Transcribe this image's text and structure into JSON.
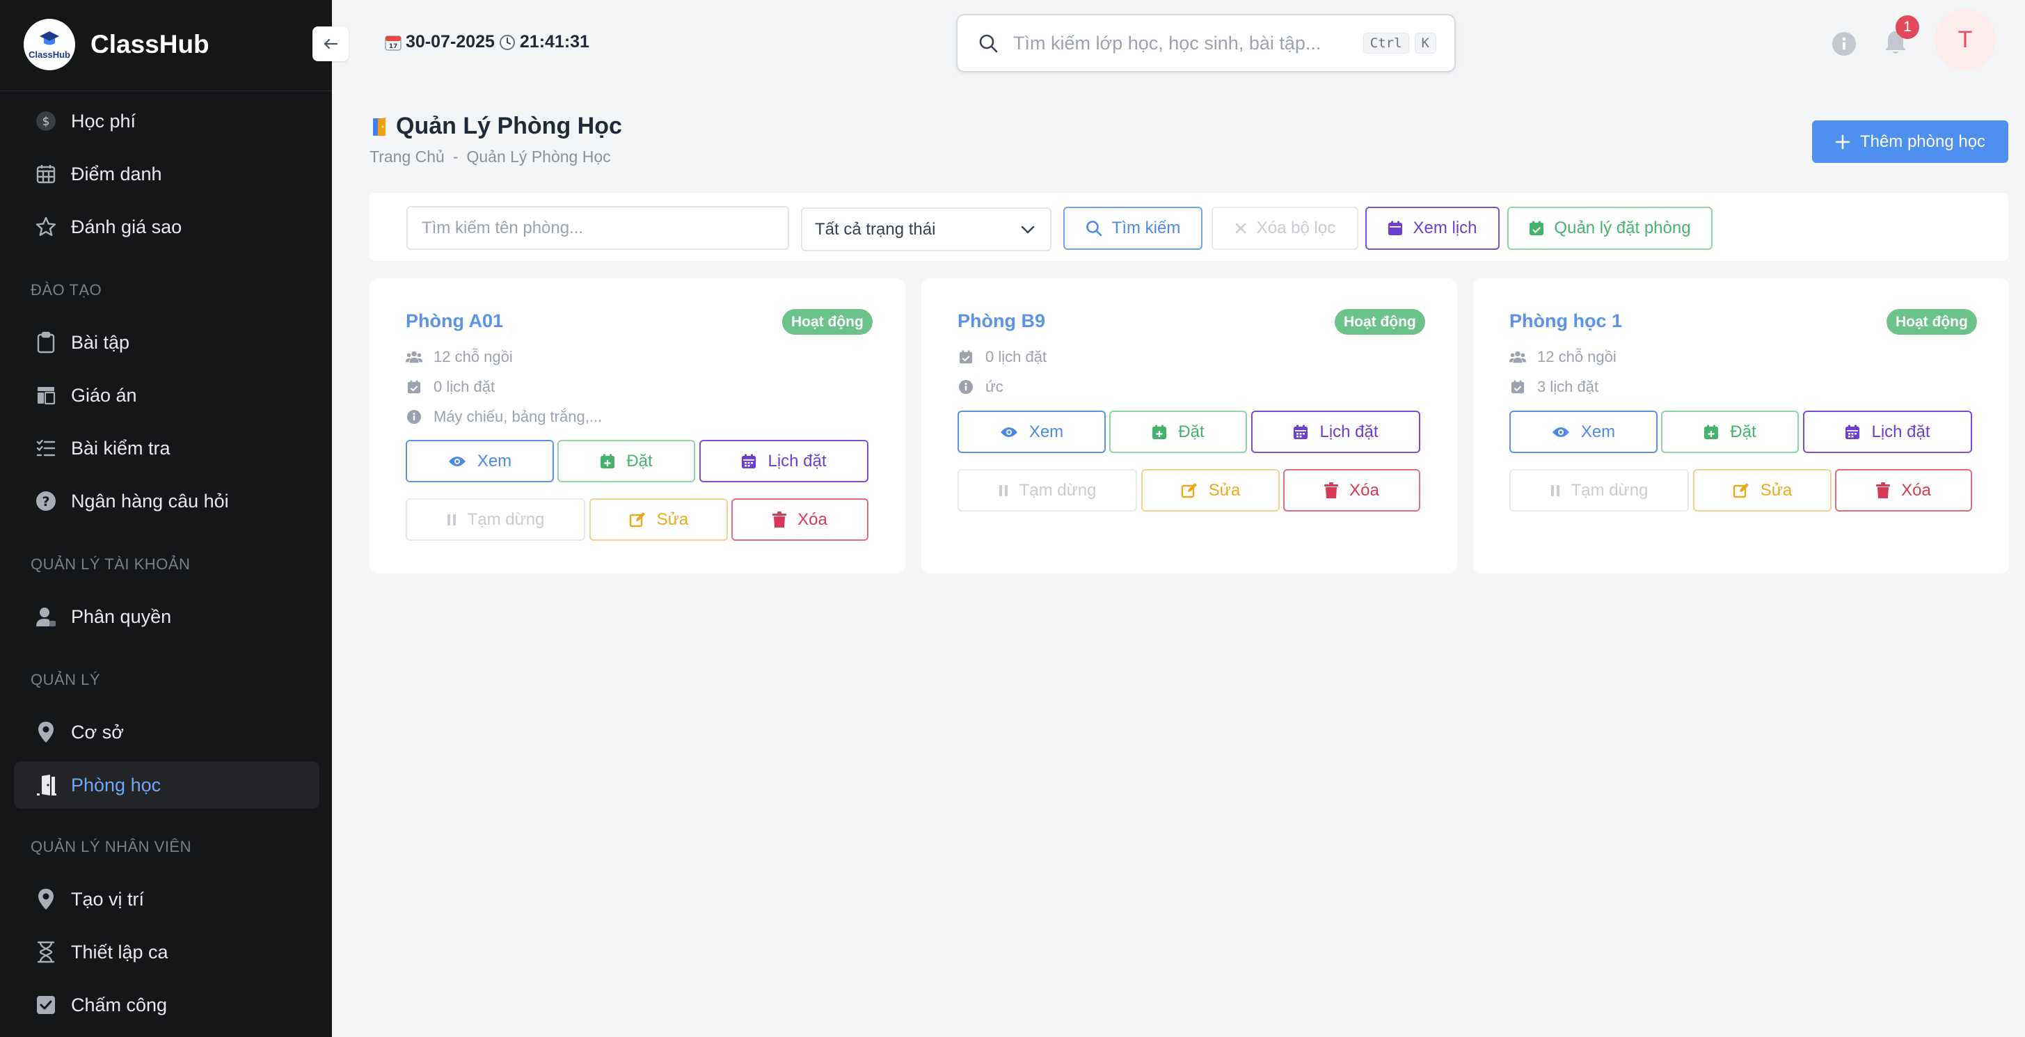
{
  "app": {
    "name": "ClassHub",
    "logo_text": "ClassHub"
  },
  "sidebar": {
    "items_top": [
      {
        "label": "Học phí",
        "icon": "dollar-icon"
      },
      {
        "label": "Điểm danh",
        "icon": "calendar-grid-icon"
      },
      {
        "label": "Đánh giá sao",
        "icon": "star-icon"
      }
    ],
    "sections": [
      {
        "title": "ĐÀO TẠO",
        "items": [
          {
            "label": "Bài tập",
            "icon": "clipboard-icon"
          },
          {
            "label": "Giáo án",
            "icon": "layout-icon"
          },
          {
            "label": "Bài kiểm tra",
            "icon": "checklist-icon"
          },
          {
            "label": "Ngân hàng câu hỏi",
            "icon": "question-icon"
          }
        ]
      },
      {
        "title": "QUẢN LÝ TÀI KHOẢN",
        "items": [
          {
            "label": "Phân quyền",
            "icon": "user-lock-icon"
          }
        ]
      },
      {
        "title": "QUẢN LÝ",
        "items": [
          {
            "label": "Cơ sở",
            "icon": "map-pin-icon"
          },
          {
            "label": "Phòng học",
            "icon": "door-open-icon",
            "active": true
          }
        ]
      },
      {
        "title": "QUẢN LÝ NHÂN VIÊN",
        "items": [
          {
            "label": "Tạo vị trí",
            "icon": "map-pin-icon"
          },
          {
            "label": "Thiết lập ca",
            "icon": "hourglass-icon"
          },
          {
            "label": "Chấm công",
            "icon": "check-square-icon"
          }
        ]
      }
    ]
  },
  "header": {
    "date": "30-07-2025",
    "time": "21:41:31",
    "search_placeholder": "Tìm kiếm lớp học, học sinh, bài tập...",
    "kbd_ctrl": "Ctrl",
    "kbd_k": "K",
    "notification_count": "1",
    "avatar_initial": "T"
  },
  "page": {
    "title": "Quản Lý Phòng Học",
    "breadcrumb": [
      "Trang Chủ",
      "-",
      "Quản Lý Phòng Học"
    ],
    "add_button": "Thêm phòng học"
  },
  "filters": {
    "search_placeholder": "Tìm kiếm tên phòng...",
    "status_select": "Tất cả trạng thái",
    "search_button": "Tìm kiếm",
    "clear_button": "Xóa bộ lọc",
    "schedule_button": "Xem lịch",
    "booking_manage_button": "Quản lý đặt phòng"
  },
  "room_actions": {
    "view": "Xem",
    "book": "Đặt",
    "schedule": "Lịch đặt",
    "pause": "Tạm dừng",
    "edit": "Sửa",
    "delete": "Xóa"
  },
  "rooms": [
    {
      "name": "Phòng A01",
      "status": "Hoạt động",
      "seats": "12 chỗ ngồi",
      "bookings": "0 lịch đặt",
      "equipment": "Máy chiếu, bảng trắng,..."
    },
    {
      "name": "Phòng B9",
      "status": "Hoạt động",
      "bookings": "0 lịch đặt",
      "equipment": "ức"
    },
    {
      "name": "Phòng học 1",
      "status": "Hoạt động",
      "seats": "12 chỗ ngồi",
      "bookings": "3 lịch đặt"
    }
  ],
  "colors": {
    "sidebar_bg": "#151618",
    "primary": "#4d90f0",
    "success": "#6cc28b",
    "purple": "#6d3fd1",
    "warning": "#eaa91c",
    "danger": "#d63a56"
  }
}
